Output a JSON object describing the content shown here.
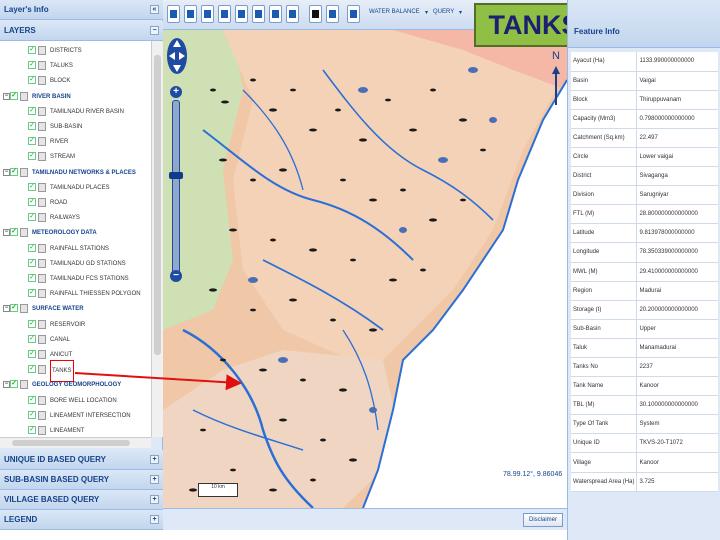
{
  "left_panel": {
    "layers_info_title": "Layer's Info",
    "layers_header": "LAYERS",
    "tree": [
      {
        "label": "DISTRICTS",
        "level": 1,
        "checked": true
      },
      {
        "label": "TALUKS",
        "level": 1,
        "checked": true
      },
      {
        "label": "BLOCK",
        "level": 1,
        "checked": true
      },
      {
        "label": "RIVER BASIN",
        "level": 0,
        "checked": true
      },
      {
        "label": "TAMILNADU RIVER BASIN",
        "level": 1,
        "checked": true
      },
      {
        "label": "SUB-BASIN",
        "level": 1,
        "checked": true
      },
      {
        "label": "RIVER",
        "level": 1,
        "checked": true
      },
      {
        "label": "STREAM",
        "level": 1,
        "checked": true
      },
      {
        "label": "TAMILNADU NETWORKS & PLACES",
        "level": 0,
        "checked": true
      },
      {
        "label": "TAMILNADU PLACES",
        "level": 1,
        "checked": true
      },
      {
        "label": "ROAD",
        "level": 1,
        "checked": true
      },
      {
        "label": "RAILWAYS",
        "level": 1,
        "checked": true
      },
      {
        "label": "METEOROLOGY DATA",
        "level": 0,
        "checked": true
      },
      {
        "label": "RAINFALL STATIONS",
        "level": 1,
        "checked": true
      },
      {
        "label": "TAMILNADU GD STATIONS",
        "level": 1,
        "checked": true
      },
      {
        "label": "TAMILNADU FCS STATIONS",
        "level": 1,
        "checked": true
      },
      {
        "label": "RAINFALL THIESSEN POLYGON",
        "level": 1,
        "checked": true
      },
      {
        "label": "SURFACE WATER",
        "level": 0,
        "checked": true
      },
      {
        "label": "RESERVOIR",
        "level": 1,
        "checked": true
      },
      {
        "label": "CANAL",
        "level": 1,
        "checked": true
      },
      {
        "label": "ANICUT",
        "level": 1,
        "checked": true
      },
      {
        "label": "TANKS",
        "level": 1,
        "checked": true,
        "highlight": true
      },
      {
        "label": "GEOLOGY GEOMORPHOLOGY",
        "level": 0,
        "checked": true
      },
      {
        "label": "BORE WELL LOCATION",
        "level": 1,
        "checked": true
      },
      {
        "label": "LINEAMENT INTERSECTION",
        "level": 1,
        "checked": true
      },
      {
        "label": "LINEAMENT",
        "level": 1,
        "checked": true
      }
    ],
    "collapsed_panels": [
      "UNIQUE ID BASED QUERY",
      "SUB-BASIN BASED QUERY",
      "VILLAGE BASED QUERY",
      "LEGEND"
    ]
  },
  "toolbar": {
    "water_balance_label": "WATER BALANCE",
    "query_label": "QUERY"
  },
  "callout": {
    "text": "TANKS"
  },
  "map": {
    "north_label": "N",
    "coords": "78.99.12°, 9.86046",
    "scale_label": "10 km",
    "disclaimer_label": "Disclaimer"
  },
  "feature_info": {
    "title": "Feature Info",
    "rows": [
      {
        "key": "Ayacut (Ha)",
        "value": "1133.990000000000"
      },
      {
        "key": "Basin",
        "value": "Vaigai"
      },
      {
        "key": "Block",
        "value": "Thiruppuvanam"
      },
      {
        "key": "Capacity (Mm3)",
        "value": "0.798000000000000"
      },
      {
        "key": "Catchment (Sq.km)",
        "value": "22.497"
      },
      {
        "key": "Circle",
        "value": "Lower vaigai"
      },
      {
        "key": "District",
        "value": "Sivaganga"
      },
      {
        "key": "Division",
        "value": "Sarugniyar"
      },
      {
        "key": "FTL (M)",
        "value": "28.800000000000000"
      },
      {
        "key": "Latitude",
        "value": "9.813978000000000"
      },
      {
        "key": "Longitude",
        "value": "78.350339000000000"
      },
      {
        "key": "MWL (M)",
        "value": "29.410000000000000"
      },
      {
        "key": "Region",
        "value": "Madurai"
      },
      {
        "key": "Storage (t)",
        "value": "20.200000000000000"
      },
      {
        "key": "Sub-Basin",
        "value": "Upper"
      },
      {
        "key": "Taluk",
        "value": "Manamadurai"
      },
      {
        "key": "Tanks No",
        "value": "2237"
      },
      {
        "key": "Tank Name",
        "value": "Kanoor"
      },
      {
        "key": "TBL (M)",
        "value": "30.100000000000000"
      },
      {
        "key": "Type Of Tank",
        "value": "System"
      },
      {
        "key": "Unique ID",
        "value": "TKVS-20-T1072"
      },
      {
        "key": "Village",
        "value": "Kanoor"
      },
      {
        "key": "Waterspread Area (Ha)",
        "value": "3.725"
      }
    ]
  },
  "colors": {
    "panel_bg": "#dfe8f6",
    "header_text": "#15428b",
    "river": "#2a6fd6",
    "callout_bg": "#8fbf45",
    "arrow": "#e01010"
  }
}
